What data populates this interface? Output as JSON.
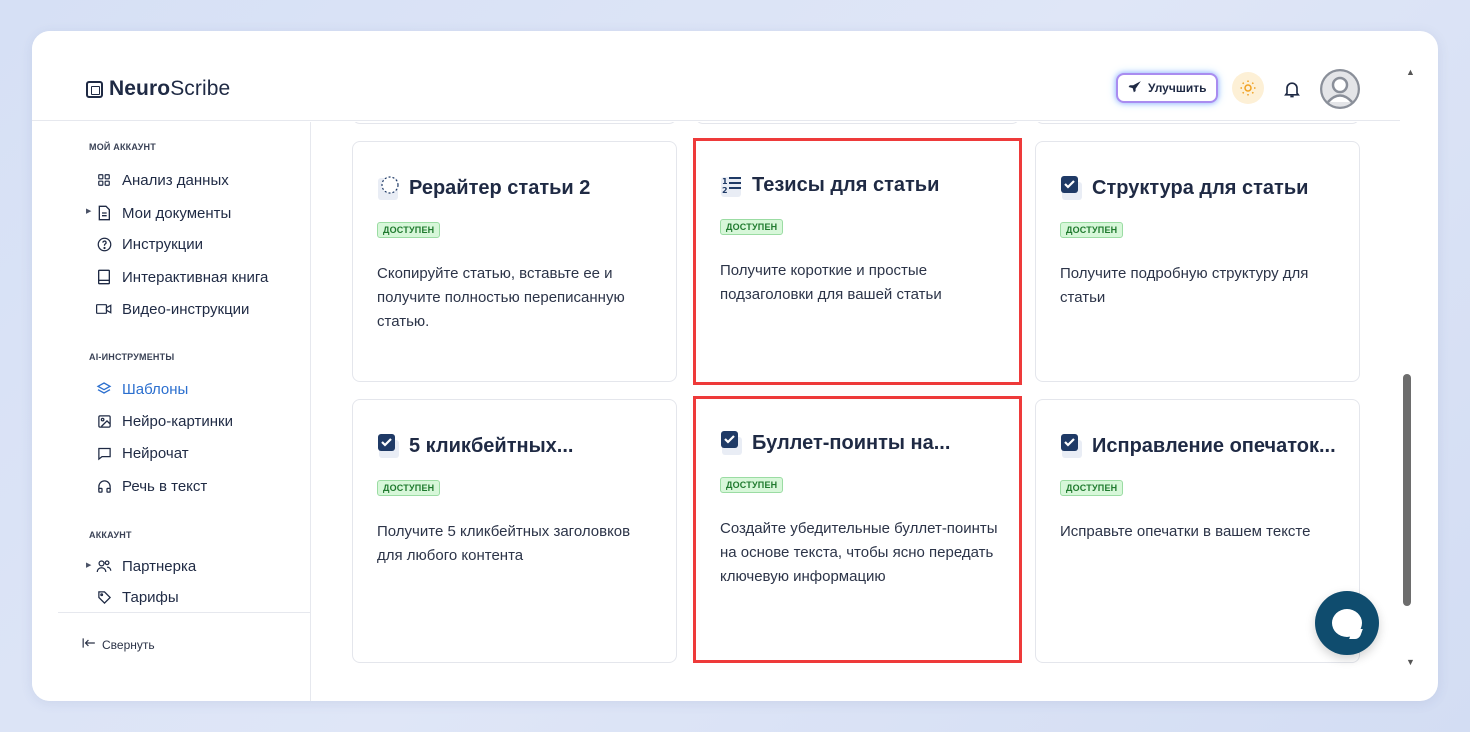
{
  "header": {
    "logo_bold": "Neuro",
    "logo_regular": "Scribe",
    "upgrade_label": "Улучшить"
  },
  "sidebar": {
    "section_account": "МОЙ АККАУНТ",
    "items_account": [
      {
        "label": "Анализ данных",
        "icon": "grid-icon"
      },
      {
        "label": "Мои документы",
        "icon": "document-icon"
      },
      {
        "label": "Инструкции",
        "icon": "help-circle-icon"
      },
      {
        "label": "Интерактивная книга",
        "icon": "book-icon"
      },
      {
        "label": "Видео-инструкции",
        "icon": "video-icon"
      }
    ],
    "section_ai": "AI-ИНСТРУМЕНТЫ",
    "items_ai": [
      {
        "label": "Шаблоны",
        "icon": "layers-icon",
        "active": true
      },
      {
        "label": "Нейро-картинки",
        "icon": "image-icon"
      },
      {
        "label": "Нейрочат",
        "icon": "chat-icon"
      },
      {
        "label": "Речь в текст",
        "icon": "headphones-icon"
      }
    ],
    "section_billing": "АККАУНТ",
    "items_billing": [
      {
        "label": "Партнерка",
        "icon": "users-icon"
      },
      {
        "label": "Тарифы",
        "icon": "tag-icon"
      }
    ],
    "collapse_label": "Свернуть"
  },
  "cards": [
    {
      "title": "Рерайтер статьи 2",
      "badge": "ДОСТУПЕН",
      "desc": "Скопируйте статью, вставьте ее и получите полностью переписанную статью.",
      "icon": "rewrite-icon"
    },
    {
      "title": "Тезисы для статьи",
      "badge": "ДОСТУПЕН",
      "desc": "Получите короткие и простые подзаголовки для вашей статьи",
      "icon": "list-numbered-icon"
    },
    {
      "title": "Структура для статьи",
      "badge": "ДОСТУПЕН",
      "desc": "Получите подробную структуру для статьи",
      "icon": "checkbox-doc-icon"
    },
    {
      "title": "5 кликбейтных...",
      "badge": "ДОСТУПЕН",
      "desc": "Получите 5 кликбейтных заголовков для любого контента",
      "icon": "checkbox-doc-icon"
    },
    {
      "title": "Буллет-поинты на...",
      "badge": "ДОСТУПЕН",
      "desc": "Создайте убедительные буллет-поинты на основе текста, чтобы ясно передать ключевую информацию",
      "icon": "checkbox-doc-icon"
    },
    {
      "title": "Исправление опечаток...",
      "badge": "ДОСТУПЕН",
      "desc": "Исправьте опечатки в вашем тексте",
      "icon": "checkbox-doc-icon"
    }
  ]
}
